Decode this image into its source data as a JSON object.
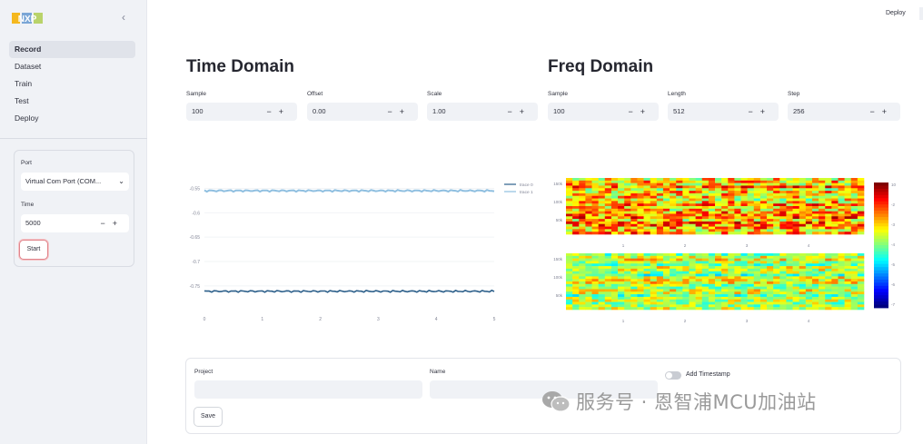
{
  "logo": "NXP",
  "sidebar": {
    "collapse_icon": "chevron-left",
    "nav": [
      {
        "label": "Record",
        "active": true
      },
      {
        "label": "Dataset"
      },
      {
        "label": "Train"
      },
      {
        "label": "Test"
      },
      {
        "label": "Deploy"
      }
    ],
    "port_label": "Port",
    "port_value": "Virtual Com Port (COM...",
    "time_label": "Time",
    "time_value": "5000",
    "start_label": "Start"
  },
  "topbar": {
    "deploy_label": "Deploy"
  },
  "time_domain": {
    "title": "Time Domain",
    "fields": [
      {
        "label": "Sample",
        "value": "100"
      },
      {
        "label": "Offset",
        "value": "0.00"
      },
      {
        "label": "Scale",
        "value": "1.00"
      }
    ]
  },
  "freq_domain": {
    "title": "Freq Domain",
    "fields": [
      {
        "label": "Sample",
        "value": "100"
      },
      {
        "label": "Length",
        "value": "512"
      },
      {
        "label": "Step",
        "value": "256"
      }
    ]
  },
  "stepper": {
    "minus": "−",
    "plus": "+"
  },
  "chart_data": [
    {
      "type": "line",
      "x_ticks": [
        "0",
        "1",
        "2",
        "3",
        "4",
        "5"
      ],
      "y_ticks": [
        "-0.55",
        "-0.6",
        "-0.65",
        "-0.7",
        "-0.75"
      ],
      "ylim": [
        -0.78,
        -0.54
      ],
      "xlim": [
        0,
        5
      ],
      "grid": true,
      "legend_position": "top-right",
      "series": [
        {
          "name": "trace 0",
          "color": "#2c5f8a",
          "values": [
            -0.761,
            -0.761,
            -0.761,
            -0.761,
            -0.761,
            -0.761
          ]
        },
        {
          "name": "trace 1",
          "color": "#8fbfe0",
          "values": [
            -0.555,
            -0.555,
            -0.555,
            -0.555,
            -0.555,
            -0.555
          ]
        }
      ]
    },
    {
      "type": "heatmap",
      "panel": "top",
      "x_ticks": [
        "1",
        "2",
        "3",
        "4"
      ],
      "y_ticks": [
        "150k",
        "100k",
        "50k"
      ],
      "palette": "jet"
    },
    {
      "type": "heatmap",
      "panel": "bottom",
      "x_ticks": [
        "1",
        "2",
        "3",
        "4"
      ],
      "y_ticks": [
        "150k",
        "100k",
        "50k"
      ],
      "palette": "jet",
      "colorbar_ticks": [
        "10",
        "-2",
        "-3",
        "-4",
        "-5",
        "-6",
        "-7"
      ]
    }
  ],
  "form": {
    "project_label": "Project",
    "name_label": "Name",
    "timestamp_label": "Add Timestamp",
    "save_label": "Save"
  },
  "watermark": "服务号 · 恩智浦MCU加油站"
}
